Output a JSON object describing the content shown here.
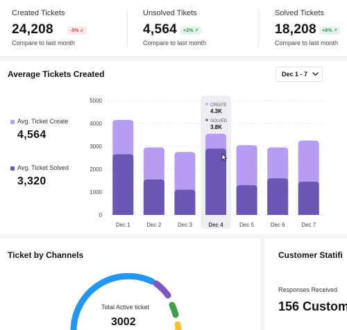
{
  "stats": [
    {
      "label": "Created Tickets",
      "value": "24,208",
      "badge": "-5% ↙",
      "trend": "down",
      "compare": "Compare to last month"
    },
    {
      "label": "Unsolved Tikets",
      "value": "4,564",
      "badge": "+2% ↗",
      "trend": "up",
      "compare": "Compare to last month"
    },
    {
      "label": "Solved Tickets",
      "value": "18,208",
      "badge": "+8% ↗",
      "trend": "up",
      "compare": "Compare to last month"
    }
  ],
  "avg_chart": {
    "title": "Average Tickets Created",
    "range_label": "Dec 1 - 7",
    "legend": [
      {
        "label": "Avg. Ticket Create",
        "value": "4,564",
        "color": "#b69cf2"
      },
      {
        "label": "Avg. Ticket Solved",
        "value": "3,320",
        "color": "#6c56b4"
      }
    ],
    "tooltip": {
      "create_label": "CREATE",
      "create_value": "4.3K",
      "solved_label": "SOLVED",
      "solved_value": "3.8K"
    }
  },
  "chart_data": {
    "type": "bar",
    "categories": [
      "Dec 1",
      "Dec 2",
      "Dec 3",
      "Dec 4",
      "Dec 5",
      "Dec 6",
      "Dec 7"
    ],
    "highlight": "Dec 4",
    "ylim": [
      0,
      5000
    ],
    "yticks": [
      "5000",
      "4000",
      "3000",
      "2000",
      "1000",
      "0"
    ],
    "grid": true,
    "series": [
      {
        "name": "Avg. Ticket Create",
        "values": [
          4150,
          2950,
          2750,
          3550,
          3050,
          2950,
          3250
        ],
        "color": "#b69cf2"
      },
      {
        "name": "Avg. Ticket Solved",
        "values": [
          2650,
          1550,
          1100,
          2900,
          1300,
          1600,
          1450
        ],
        "color": "#6c56b4"
      }
    ]
  },
  "channels": {
    "title": "Ticket by Channels",
    "total_label": "Total Active ticket",
    "total_value": "3002",
    "colors": [
      "#2196f3",
      "#7e57c2",
      "#43a047",
      "#fbc02d"
    ]
  },
  "customer": {
    "title": "Customer Statifi",
    "label": "Responses Received",
    "value": "156 Custome"
  }
}
